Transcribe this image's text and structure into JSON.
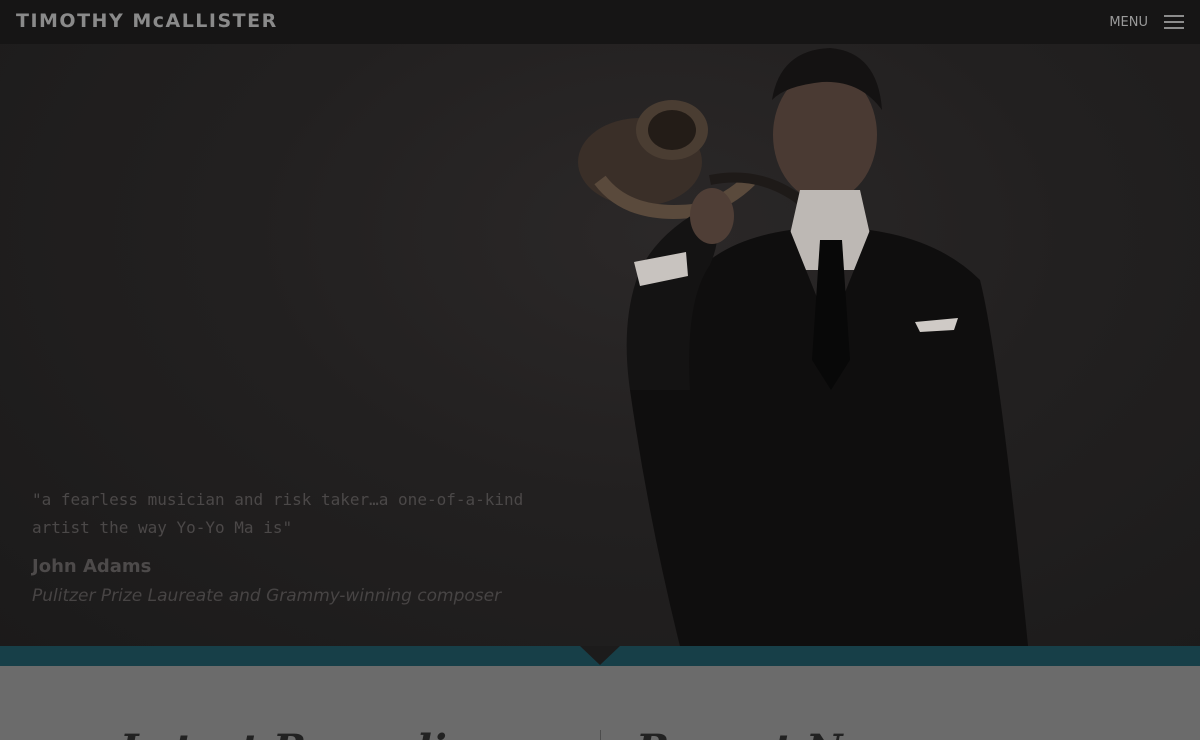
{
  "site": {
    "title": "TIMOTHY McALLISTER",
    "menu_label": "MENU"
  },
  "icons": {
    "menu": "hamburger-icon"
  },
  "hero": {
    "quote": "\"a fearless musician and risk taker…a one-of-a-kind artist the way Yo-Yo Ma is\"",
    "author": "John Adams",
    "author_title": "Pulitzer Prize Laureate and Grammy-winning composer"
  },
  "colors": {
    "accent_band": "#173f48",
    "header_bg": "#161515",
    "lower_bg": "#6b6b6b"
  },
  "lower": {
    "left_heading": "Latest Recording",
    "right_heading": "Recent News"
  }
}
